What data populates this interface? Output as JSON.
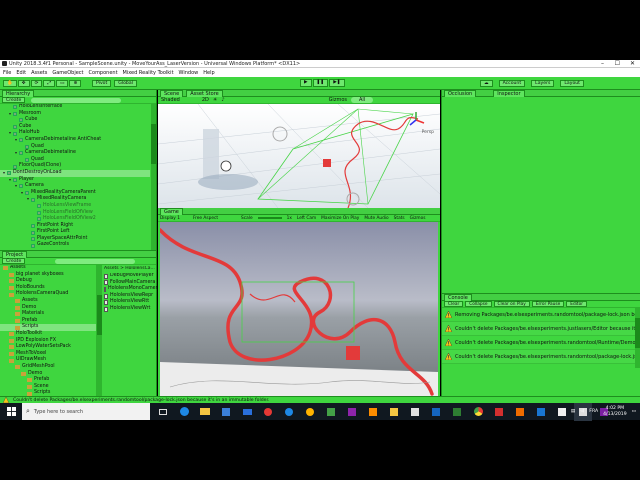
{
  "window": {
    "title": "Unity 2018.3.4f1 Personal - SampleScene.unity - MoveYourAss_LaserVersion - Universal Windows Platform* <DX11>"
  },
  "menu": [
    "File",
    "Edit",
    "Assets",
    "GameObject",
    "Component",
    "Mixed Reality Toolkit",
    "Window",
    "Help"
  ],
  "toolbar": {
    "pivot": "Pivot",
    "global": "Global",
    "account": "Account",
    "layers": "Layers",
    "layout": "Layout"
  },
  "hierarchy": {
    "tab": "Hierarchy",
    "create": "Create",
    "items": [
      {
        "label": "HoloLensInterface",
        "indent": 1,
        "arrow": ""
      },
      {
        "label": "Mesroom",
        "indent": 1,
        "arrow": "▾"
      },
      {
        "label": "Cube",
        "indent": 2,
        "arrow": ""
      },
      {
        "label": "Cube",
        "indent": 1,
        "arrow": ""
      },
      {
        "label": "HaloHub",
        "indent": 1,
        "arrow": "▾"
      },
      {
        "label": "CameraDebimetaline AntiCheat",
        "indent": 2,
        "arrow": "▾"
      },
      {
        "label": "Quad",
        "indent": 3,
        "arrow": ""
      },
      {
        "label": "CameraDebimetaline",
        "indent": 2,
        "arrow": "▾"
      },
      {
        "label": "Quad",
        "indent": 3,
        "arrow": ""
      },
      {
        "label": "FloorQuad(Clone)",
        "indent": 1,
        "arrow": ""
      },
      {
        "label": "DontDestroyOnLoad",
        "indent": 0,
        "arrow": "▾"
      },
      {
        "label": "Player",
        "indent": 1,
        "arrow": "▾"
      },
      {
        "label": "Camera",
        "indent": 2,
        "arrow": "▾"
      },
      {
        "label": "MixedRealityCameraParent",
        "indent": 3,
        "arrow": "▾"
      },
      {
        "label": "MixedRealityCamera",
        "indent": 4,
        "arrow": "▾"
      },
      {
        "label": "HoloLensViewFrame",
        "indent": 5,
        "arrow": ""
      },
      {
        "label": "HoloLensFieldOfView",
        "indent": 5,
        "arrow": ""
      },
      {
        "label": "HoloLensFieldOfView2",
        "indent": 5,
        "arrow": ""
      },
      {
        "label": "FirstPoint Right",
        "indent": 4,
        "arrow": ""
      },
      {
        "label": "FirstPoint Left",
        "indent": 4,
        "arrow": ""
      },
      {
        "label": "PlayerSpaceAttrPoint",
        "indent": 4,
        "arrow": ""
      },
      {
        "label": "GazeControls",
        "indent": 4,
        "arrow": ""
      }
    ]
  },
  "scene": {
    "tabs": [
      "Scene",
      "Asset Store"
    ],
    "shaded": "Shaded",
    "mode2d": "2D",
    "gizmos": "Gizmos",
    "search": "All",
    "persp": "Persp"
  },
  "game": {
    "tab": "Game",
    "display": "Display 1",
    "aspect": "Free Aspect",
    "scale_label": "Scale",
    "scale_val": "1x",
    "leftcam": "Left Cam",
    "maximize": "Maximize On Play",
    "mute": "Mute Audio",
    "stats": "Stats",
    "gizmos": "Gizmos"
  },
  "inspector": {
    "tabs": [
      "Occlusion",
      "Inspector"
    ]
  },
  "project": {
    "tab": "Project",
    "create": "Create",
    "tree": [
      {
        "label": "Assets",
        "indent": 0
      },
      {
        "label": "big planet skyboxes",
        "indent": 1
      },
      {
        "label": "Debug",
        "indent": 1
      },
      {
        "label": "HoloBounds",
        "indent": 1
      },
      {
        "label": "HololensCameraQuad",
        "indent": 1
      },
      {
        "label": "Assets",
        "indent": 2
      },
      {
        "label": "Demo",
        "indent": 2
      },
      {
        "label": "Materials",
        "indent": 2
      },
      {
        "label": "Prefab",
        "indent": 2
      },
      {
        "label": "Scripts",
        "indent": 2
      },
      {
        "label": "HoloToolkit",
        "indent": 1
      },
      {
        "label": "IPD Explosion FX",
        "indent": 1
      },
      {
        "label": "LowPolyWaterSetsPack",
        "indent": 1
      },
      {
        "label": "MeshToVoxel",
        "indent": 1
      },
      {
        "label": "UIDrawMesh",
        "indent": 1
      },
      {
        "label": "GridMeshPool",
        "indent": 2
      },
      {
        "label": "Demo",
        "indent": 3
      },
      {
        "label": "Prefab",
        "indent": 4
      },
      {
        "label": "Scene",
        "indent": 4
      },
      {
        "label": "Scripts",
        "indent": 4
      }
    ],
    "breadcrumb": "Assets > HololensCa...",
    "files": [
      "DebugMovePlayer",
      "FollowMainCamera",
      "HololensMonoCamera",
      "HololensViewRepr",
      "HololensViewRtt",
      "HololensViewWrt"
    ]
  },
  "console": {
    "tab": "Console",
    "buttons": [
      "Clear",
      "Collapse",
      "Clear on Play",
      "Error Pause",
      "Editor"
    ],
    "lines": [
      "Removing Packages/be.elsexperiments.randomtool/package-lock.json because it...",
      "Couldn't delete Packages/be.elsexperiments.justlasers/Editor because it's in another pro...",
      "Couldn't delete Packages/be.elsexperiments.randomtool/Runtime/Demo because it's...",
      "Couldn't delete Packages/be.elsexperiments.randomtool/package-lock.json because it's in..."
    ]
  },
  "statusbar": "Couldn't delete Packages/be.elsexperiments.randomtool/package-lock.json because it's in an immutable folder.",
  "taskbar": {
    "search": "Type here to search",
    "time": "4:02 PM",
    "date": "4/13/2019",
    "lang": "FRA"
  },
  "colors": {
    "accent_green": "#3fd63f",
    "laser_red": "#e33a3a",
    "taskbar": "#101820"
  }
}
